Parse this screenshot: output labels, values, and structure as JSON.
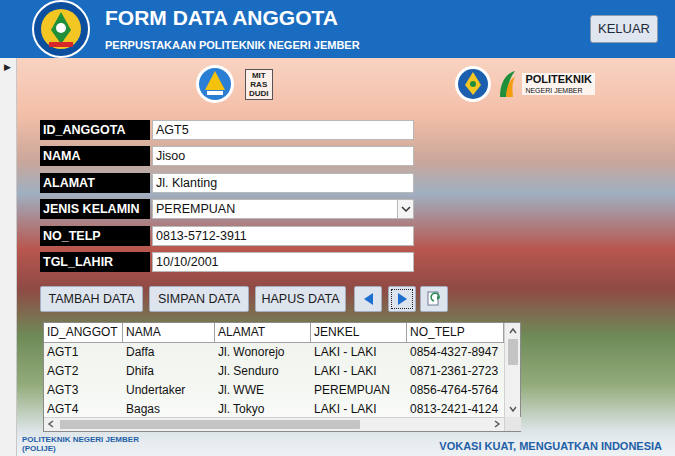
{
  "window": {
    "title": "FORM DATA ANGGOTA",
    "subtitle": "PERPUSTAKAAN POLITEKNIK NEGERI JEMBER"
  },
  "header_buttons": [
    "KELUAR"
  ],
  "record_selector": "▶",
  "banner": {
    "mitras": [
      "MIT",
      "RAS",
      "DUDI"
    ],
    "polije": [
      "POLITEKNIK",
      "NEGERI JEMBER"
    ]
  },
  "form": {
    "fields": [
      {
        "label": "ID_ANGGOTA",
        "value": "AGT5",
        "kind": "text"
      },
      {
        "label": "NAMA",
        "value": "Jisoo",
        "kind": "text"
      },
      {
        "label": "ALAMAT",
        "value": "Jl. Klanting",
        "kind": "text"
      },
      {
        "label": "JENIS KELAMIN",
        "value": "PEREMPUAN",
        "kind": "dropdown"
      },
      {
        "label": "NO_TELP",
        "value": "0813-5712-3911",
        "kind": "text"
      },
      {
        "label": "TGL_LAHIR",
        "value": "10/10/2001",
        "kind": "text"
      }
    ]
  },
  "buttons": [
    "TAMBAH DATA",
    "SIMPAN DATA",
    "HAPUS DATA"
  ],
  "nav": [
    {
      "kind": "previous",
      "focused": false
    },
    {
      "kind": "next",
      "focused": true
    },
    {
      "kind": "refresh",
      "focused": false
    }
  ],
  "table": {
    "columns": [
      "ID_ANGGOT",
      "NAMA",
      "ALAMAT",
      "JENKEL",
      "NO_TELP"
    ],
    "rows": [
      [
        "AGT1",
        "Daffa",
        "Jl. Wonorejo",
        "LAKI - LAKI",
        "0854-4327-8947"
      ],
      [
        "AGT2",
        "Dhifa",
        "Jl. Senduro",
        "LAKI - LAKI",
        "0871-2361-2723"
      ],
      [
        "AGT3",
        "Undertaker",
        "Jl. WWE",
        "PEREMPUAN",
        "0856-4764-5764"
      ],
      [
        "AGT4",
        "Bagas",
        "Jl. Tokyo",
        "LAKI - LAKI",
        "0813-2421-4124"
      ]
    ]
  },
  "footer": {
    "left": [
      "POLITEKNIK NEGERI JEMBER",
      "(POLIJE)"
    ],
    "right": "VOKASI KUAT, MENGUATKAN INDONESIA"
  }
}
